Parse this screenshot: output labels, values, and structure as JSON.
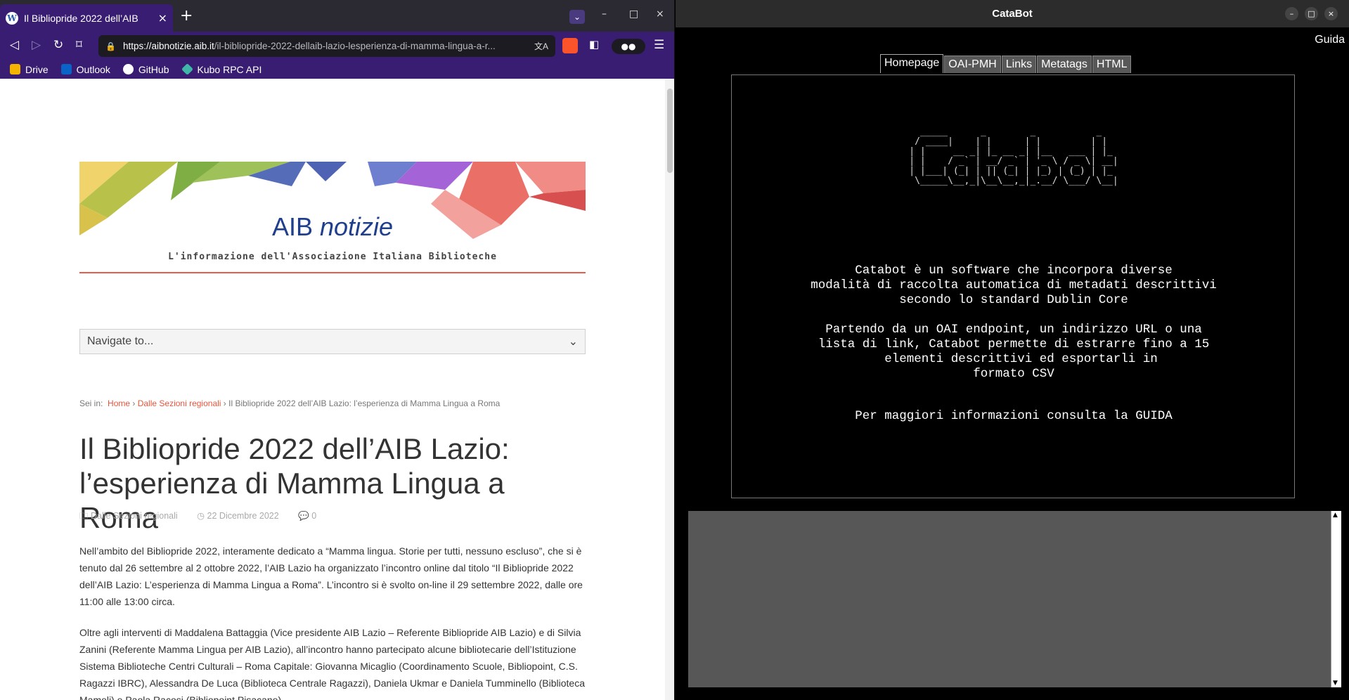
{
  "browser": {
    "tab_title": "Il Bibliopride 2022 dell’AIB",
    "new_tab": "+",
    "window_controls": [
      "–",
      "□",
      "×"
    ],
    "url_host": "https://aibnotizie.aib.it",
    "url_path": "/il-bibliopride-2022-dellaib-lazio-lesperienza-di-mamma-lingua-a-r...",
    "bookmarks": [
      {
        "label": "Drive",
        "icon": "drive-icon",
        "color": "#f4b400"
      },
      {
        "label": "Outlook",
        "icon": "outlook-icon",
        "color": "#0a64c8"
      },
      {
        "label": "GitHub",
        "icon": "github-icon",
        "color": "#ffffff"
      },
      {
        "label": "Kubo RPC API",
        "icon": "kubo-icon",
        "color": "#3fb6a8"
      }
    ]
  },
  "page": {
    "banner_title_plain": "AIB ",
    "banner_title_italic": "notizie",
    "banner_subtitle": "L'informazione dell'Associazione Italiana Biblioteche",
    "nav_select": "Navigate to...",
    "breadcrumb_prefix": "Sei in:",
    "breadcrumb_home": "Home",
    "breadcrumb_section": "Dalle Sezioni regionali",
    "breadcrumb_current": "Il Bibliopride 2022 dell’AIB Lazio: l’esperienza di Mamma Lingua a Roma",
    "article_title": "Il Bibliopride 2022 dell’AIB Lazio: l’esperienza di Mamma Lingua a Roma",
    "meta_category": "Dalle Sezioni regionali",
    "meta_date": "22 Dicembre 2022",
    "meta_comments": "0",
    "paragraph_1": "Nell’ambito del Bibliopride 2022, interamente dedicato a “Mamma lingua. Storie per tutti, nessuno escluso”, che si è tenuto dal 26 settembre al 2 ottobre 2022, l’AIB Lazio ha organizzato l’incontro online dal titolo “Il Bibliopride 2022 dell’AIB Lazio: L’esperienza di Mamma Lingua a Roma”. L’incontro si è svolto on-line il 29 settembre 2022, dalle ore 11:00 alle 13:00 circa.",
    "paragraph_2": "Oltre agli interventi di Maddalena Battaggia (Vice presidente AIB Lazio – Referente Bibliopride AIB Lazio) e di Silvia Zanini (Referente Mamma Lingua per AIB Lazio), all’incontro hanno partecipato alcune bibliotecarie dell’Istituzione Sistema Biblioteche Centri Culturali – Roma Capitale: Giovanna Micaglio (Coordinamento Scuole, Bibliopoint, C.S. Ragazzi IBRC), Alessandra De Luca (Biblioteca Centrale Ragazzi), Daniela Ukmar e Daniela Tumminello (Biblioteca Mameli) e Paola Racosi (Bibliopoint Pisacane)"
  },
  "catabot": {
    "window_title": "CataBot",
    "guida_link": "Guida",
    "tabs": [
      "Homepage",
      "OAI-PMH",
      "Links",
      "Metatags",
      "HTML"
    ],
    "active_tab": "Homepage",
    "ascii_logo": "  _____      _        _           _   \n / ____|    | |      | |         | |  \n| |     __ _| |_ __ _| |__   ___ | |_ \n| |    / _` | __/ _` | '_ \\ / _ \\| __|\n| |___| (_| | || (_| | |_) | (_) | |_ \n \\_____\\__,_|\\__\\__,_|_.__/ \\___/ \\__|",
    "intro_1": "Catabot è un software che incorpora diverse\nmodalità di raccolta automatica di metadati descrittivi\nsecondo lo standard Dublin Core",
    "intro_2": "Partendo da un OAI endpoint, un indirizzo URL o una\nlista di link, Catabot permette di estrarre fino a 15\n  elementi descrittivi ed esportarli in\nformato CSV",
    "more_info_prefix": "Per maggiori informazioni consulta la ",
    "more_info_link": "GUIDA",
    "window_controls": [
      "–",
      "□",
      "×"
    ]
  }
}
